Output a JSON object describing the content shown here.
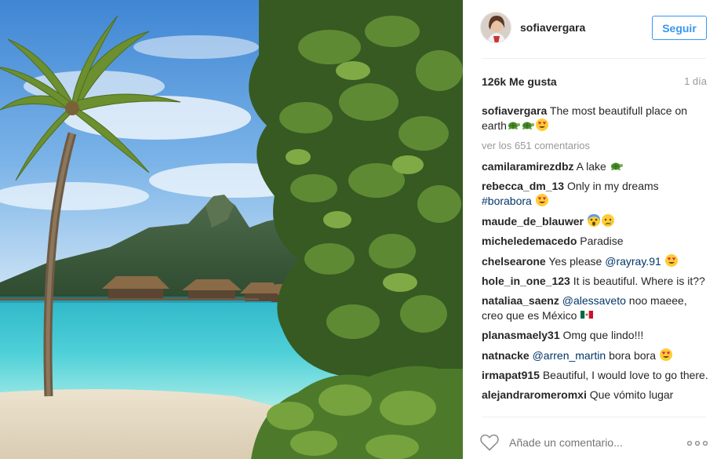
{
  "header": {
    "username": "sofiavergara",
    "follow_label": "Seguir"
  },
  "meta": {
    "likes": "126k Me gusta",
    "time": "1 día"
  },
  "caption": {
    "user": "sofiavergara",
    "text": "The most beautifull place on earth",
    "emojis": [
      "turtle-emoji",
      "turtle-emoji",
      "heart-eyes-emoji"
    ]
  },
  "view_all": "ver los 651 comentarios",
  "comments": [
    {
      "user": "camilaramirezdbz",
      "pre": "A lake",
      "mention": "",
      "hashtag": "",
      "post": "",
      "emojis": [
        "turtle-emoji"
      ]
    },
    {
      "user": "rebecca_dm_13",
      "pre": "Only in my dreams",
      "mention": "",
      "hashtag": "#borabora",
      "post": "",
      "emojis": [
        "heart-eyes-emoji"
      ]
    },
    {
      "user": "maude_de_blauwer",
      "pre": "",
      "mention": "",
      "hashtag": "",
      "post": "",
      "emojis": [
        "scream-emoji",
        "cry-emoji"
      ]
    },
    {
      "user": "micheledemacedo",
      "pre": "Paradise",
      "mention": "",
      "hashtag": "",
      "post": "",
      "emojis": []
    },
    {
      "user": "chelsearone",
      "pre": "Yes please",
      "mention": "@rayray.91",
      "hashtag": "",
      "post": "",
      "emojis": [
        "heart-eyes-emoji"
      ]
    },
    {
      "user": "hole_in_one_123",
      "pre": "It is beautiful. Where is it??",
      "mention": "",
      "hashtag": "",
      "post": "",
      "emojis": []
    },
    {
      "user": "nataliaa_saenz",
      "pre": "",
      "mention": "@alessaveto",
      "hashtag": "",
      "post": "noo maeee, creo que es México",
      "emojis": [
        "mexico-flag-emoji"
      ]
    },
    {
      "user": "planasmaely31",
      "pre": "Omg que lindo!!!",
      "mention": "",
      "hashtag": "",
      "post": "",
      "emojis": []
    },
    {
      "user": "natnacke",
      "pre": "",
      "mention": "@arren_martin",
      "hashtag": "",
      "post": "bora bora",
      "emojis": [
        "heart-eyes-emoji"
      ]
    },
    {
      "user": "irmapat915",
      "pre": "Beautiful, I would love to go there.",
      "mention": "",
      "hashtag": "",
      "post": "",
      "emojis": []
    },
    {
      "user": "alejandraromeromxi",
      "pre": "Que vómito lugar",
      "mention": "",
      "hashtag": "",
      "post": "",
      "emojis": []
    }
  ],
  "add_comment": {
    "placeholder": "Añade un comentario...",
    "more_icon": "ellipsis-icon",
    "like_icon": "heart-outline-icon"
  },
  "colors": {
    "accent": "#3897f0",
    "link": "#003569",
    "muted": "#999999"
  }
}
